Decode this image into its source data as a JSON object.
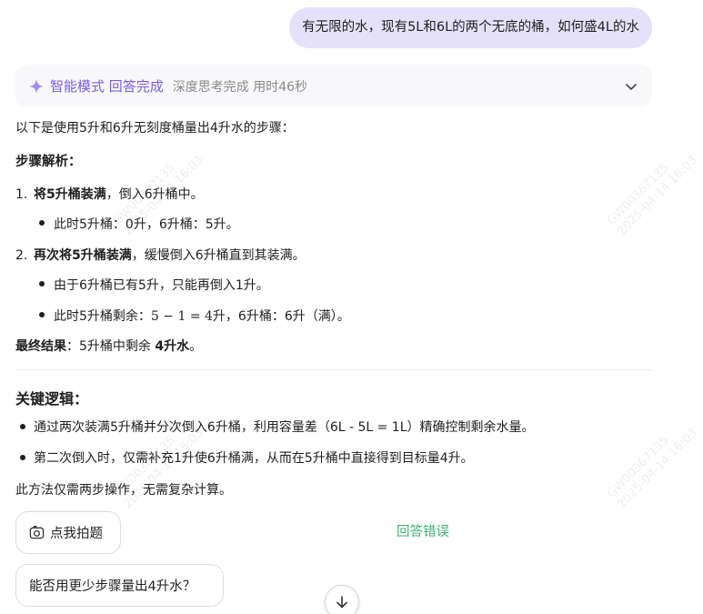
{
  "watermark": {
    "line1": "GW00367135",
    "line2": "2025-04-14 16:03"
  },
  "user_message": "有无限的水，现有5L和6L的两个无底的桶，如何盛4L的水",
  "status": {
    "title": "智能模式 回答完成",
    "subtitle": "深度思考完成 用时46秒"
  },
  "answer": {
    "intro": "以下是使用5升和6升无刻度桶量出4升水的步骤：",
    "section_title": "步骤解析：",
    "step1": {
      "num": "1.",
      "bold": "将5升桶装满",
      "rest": "，倒入6升桶中。",
      "bullet1": "此时5升桶：0升，6升桶：5升。"
    },
    "step2": {
      "num": "2.",
      "bold": "再次将5升桶装满",
      "rest": "，缓慢倒入6升桶直到其装满。",
      "bullet1": "由于6升桶已有5升，只能再倒入1升。",
      "bullet2_pre": "此时5升桶剩余：",
      "bullet2_math": "5 − 1 = 4",
      "bullet2_post": "升，6升桶：6升（满）。"
    },
    "result": {
      "label": "最终结果",
      "text": "：5升桶中剩余 ",
      "bold": "4升水",
      "end": "。"
    },
    "logic_title": "关键逻辑：",
    "logic1": "通过两次装满5升桶并分次倒入6升桶，利用容量差（6L - 5L = 1L）精确控制剩余水量。",
    "logic2": "第二次倒入时，仅需补充1升使6升桶满，从而在5升桶中直接得到目标量4升。",
    "conclusion": "此方法仅需两步操作，无需复杂计算。"
  },
  "actions": {
    "photo_button": "点我拍题",
    "wrong_label": "回答错误",
    "suggestion": "能否用更少步骤量出4升水？"
  },
  "colors": {
    "accent": "#7b5ce6",
    "bubble": "#e5e1fb",
    "wrong": "#3cb371"
  }
}
